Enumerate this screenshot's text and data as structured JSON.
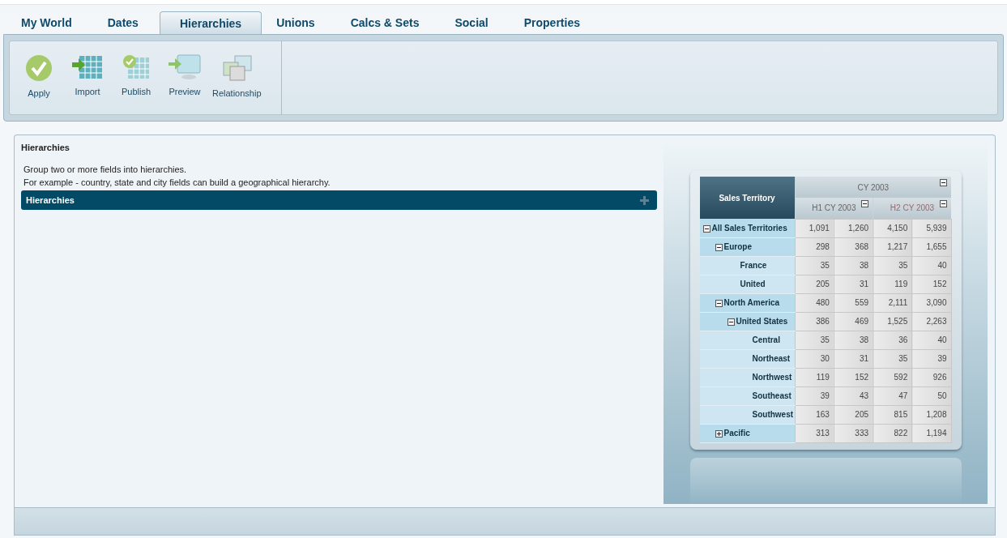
{
  "tabs": [
    {
      "label": "My World",
      "selected": false
    },
    {
      "label": "Dates",
      "selected": false
    },
    {
      "label": "Hierarchies",
      "selected": true
    },
    {
      "label": "Unions",
      "selected": false
    },
    {
      "label": "Calcs & Sets",
      "selected": false
    },
    {
      "label": "Social",
      "selected": false
    },
    {
      "label": "Properties",
      "selected": false
    }
  ],
  "toolbar": [
    {
      "label": "Apply",
      "kind": "apply"
    },
    {
      "label": "Import",
      "kind": "import"
    },
    {
      "label": "Publish",
      "kind": "publish"
    },
    {
      "label": "Preview",
      "kind": "preview"
    },
    {
      "label": "Relationship",
      "kind": "relationship"
    }
  ],
  "panel": {
    "title": "Hierarchies",
    "description": [
      "Group two or more fields into hierarchies.",
      "For example - country, state and city fields can build a geographical hierarchy."
    ],
    "section": {
      "title": "Hierarchies"
    }
  },
  "preview_table": {
    "corner": "Sales Territory",
    "column_group": {
      "label": "CY 2003",
      "expanded": true
    },
    "columns": [
      {
        "label": "H1 CY 2003",
        "expanded": true
      },
      {
        "label": "H2 CY 2003",
        "expanded": true
      }
    ],
    "rows": [
      {
        "label": "All Sales Territories",
        "expanded": true,
        "values": [
          "1,091",
          "1,260",
          "4,150",
          "5,939"
        ],
        "children": [
          {
            "label": "Europe",
            "expanded": true,
            "values": [
              "298",
              "368",
              "1,217",
              "1,655"
            ],
            "children": [
              {
                "label": "France",
                "values": [
                  "35",
                  "38",
                  "35",
                  "40"
                ]
              },
              {
                "label": "United",
                "values": [
                  "205",
                  "31",
                  "119",
                  "152"
                ]
              }
            ]
          },
          {
            "label": "North America",
            "expanded": true,
            "values": [
              "480",
              "559",
              "2,111",
              "3,090"
            ],
            "children": [
              {
                "label": "United States",
                "expanded": true,
                "values": [
                  "386",
                  "469",
                  "1,525",
                  "2,263"
                ],
                "children": [
                  {
                    "label": "Central",
                    "values": [
                      "35",
                      "38",
                      "36",
                      "40"
                    ]
                  },
                  {
                    "label": "Northeast",
                    "values": [
                      "30",
                      "31",
                      "35",
                      "39"
                    ]
                  },
                  {
                    "label": "Northwest",
                    "values": [
                      "119",
                      "152",
                      "592",
                      "926"
                    ]
                  },
                  {
                    "label": "Southeast",
                    "values": [
                      "39",
                      "43",
                      "47",
                      "50"
                    ]
                  },
                  {
                    "label": "Southwest",
                    "values": [
                      "163",
                      "205",
                      "815",
                      "1,208"
                    ]
                  }
                ]
              }
            ]
          },
          {
            "label": "Pacific",
            "expanded": false,
            "values": [
              "313",
              "333",
              "822",
              "1,194"
            ]
          }
        ]
      }
    ]
  }
}
